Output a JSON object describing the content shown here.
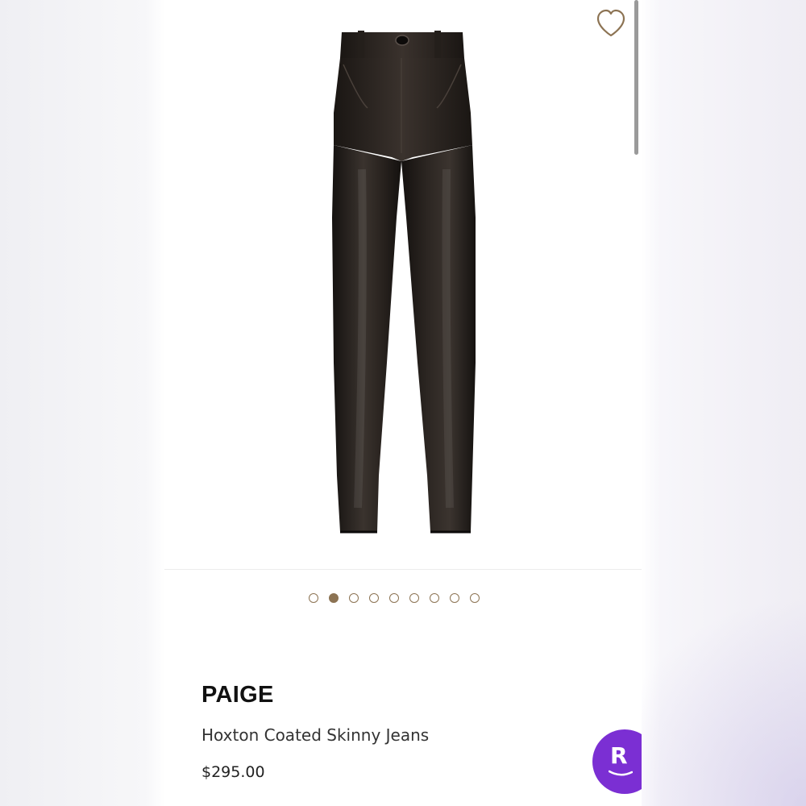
{
  "favorite": {
    "icon": "heart-outline-icon"
  },
  "gallery": {
    "image_alt": "PAIGE Hoxton Coated Skinny Jeans",
    "total_images": 9,
    "active_index": 2
  },
  "product": {
    "brand": "PAIGE",
    "name": "Hoxton Coated Skinny Jeans",
    "price": "$295.00"
  },
  "rakuten": {
    "label": "R",
    "icon": "rakuten-r-icon",
    "color": "#7b2fd3"
  },
  "colors": {
    "accent": "#8c7353",
    "brand_purple": "#7b2fd3",
    "product_black": "#1e1a17"
  }
}
